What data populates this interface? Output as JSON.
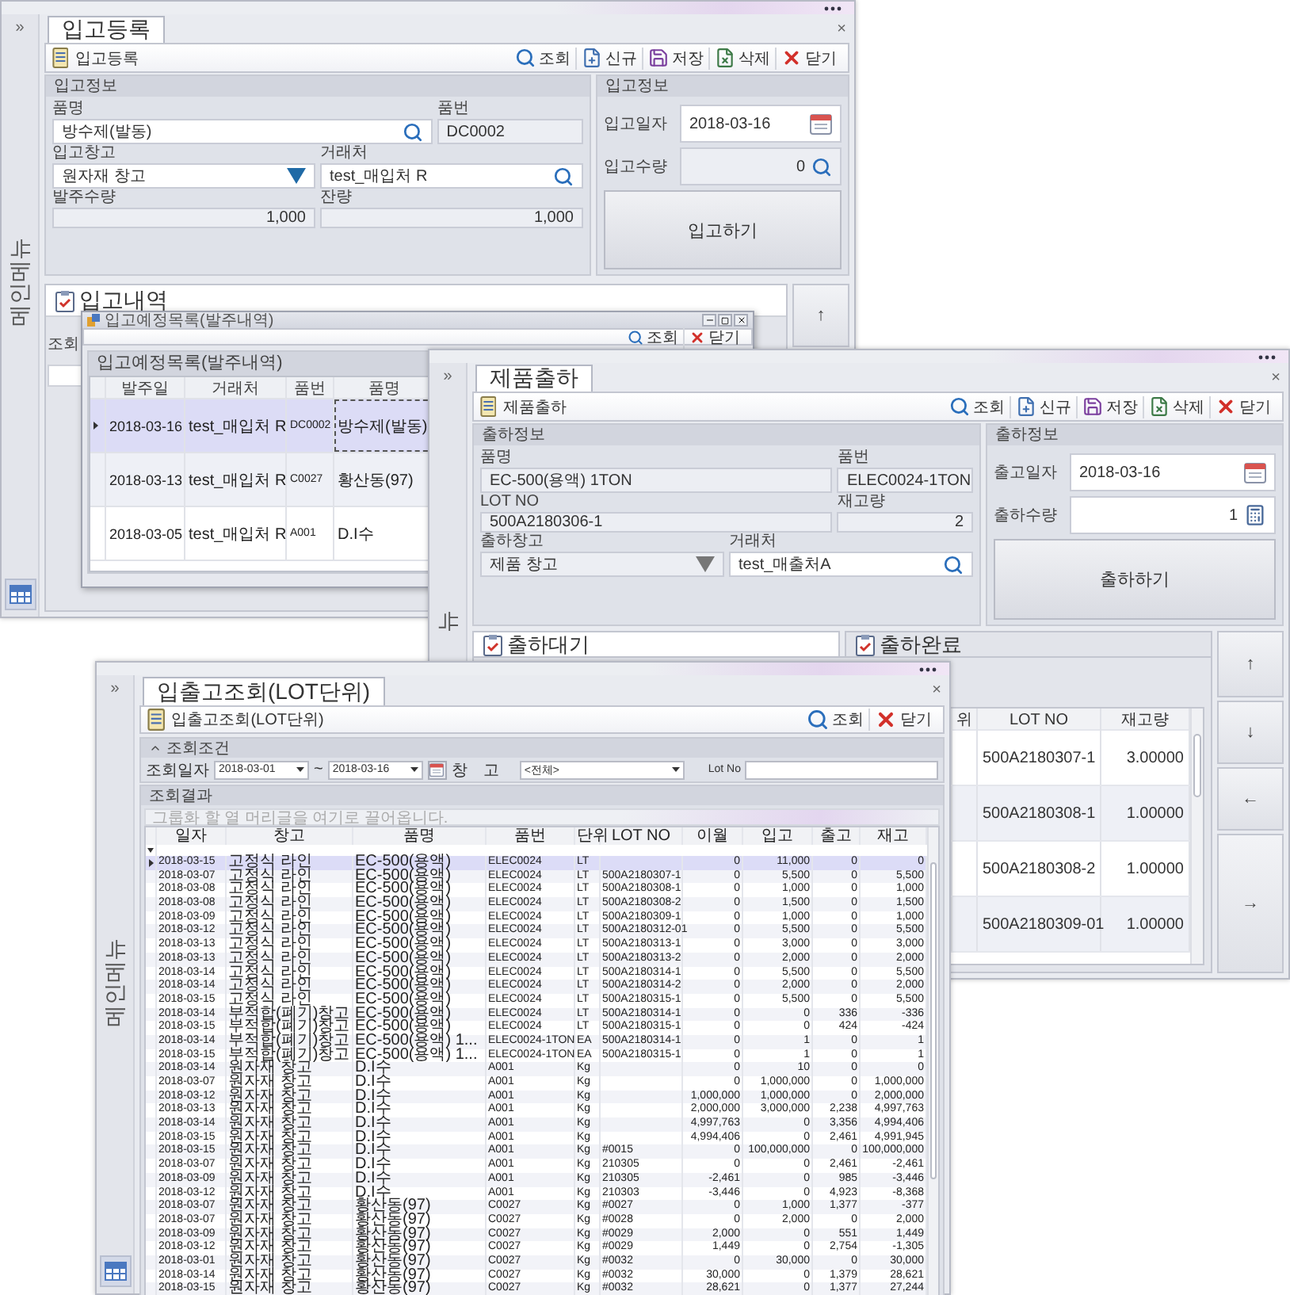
{
  "receipt_window": {
    "side_menu": {
      "expand": "»",
      "label": "메인메뉴",
      "shortcut_button": true
    },
    "tab": {
      "label": "입고등록",
      "close": "×"
    },
    "toolbar": {
      "title": "입고등록",
      "buttons": [
        {
          "kind": "search",
          "label": "조회"
        },
        {
          "kind": "new",
          "label": "신규"
        },
        {
          "kind": "save",
          "label": "저장"
        },
        {
          "kind": "delete",
          "label": "삭제"
        },
        {
          "kind": "close",
          "label": "닫기"
        }
      ]
    },
    "info": {
      "title": "입고정보",
      "rows": [
        {
          "kind": "wide-narrow",
          "fields": [
            {
              "label": "품명",
              "kind": "search",
              "value": "방수제(발동)"
            },
            {
              "label": "품번",
              "kind": "text",
              "value": "DC0002"
            }
          ]
        },
        {
          "kind": "even",
          "fields": [
            {
              "label": "입고창고",
              "kind": "dropdown",
              "disabled": false,
              "value": "원자재 창고"
            },
            {
              "label": "거래처",
              "kind": "search",
              "value": "test_매입처 R"
            }
          ]
        },
        {
          "kind": "even",
          "fields": [
            {
              "label": "발주수량",
              "kind": "amount",
              "value": "1,000"
            },
            {
              "label": "잔량",
              "kind": "amount",
              "value": "1,000"
            }
          ]
        }
      ]
    },
    "entry": {
      "title": "입고정보",
      "fields": [
        {
          "label": "입고일자",
          "kind": "date",
          "value": "2018-03-16"
        },
        {
          "label": "입고수량",
          "kind": "search-amount",
          "value": "0"
        }
      ],
      "action": "입고하기"
    },
    "history": {
      "title": "입고내역",
      "search_label": "조회",
      "side_buttons": [
        "↑"
      ]
    },
    "dialog": {
      "title": "입고예정목록(발주내역)",
      "toolbar": [
        {
          "kind": "search",
          "label": "조회"
        },
        {
          "kind": "close",
          "label": "닫기"
        }
      ],
      "group_title": "입고예정목록(발주내역)",
      "columns": [
        "발주일",
        "거래처",
        "품번",
        "품명"
      ],
      "rows": [
        {
          "selected": true,
          "cells": [
            "2018-03-16",
            "test_매입처 R",
            "DC0002",
            "방수제(발동)"
          ]
        },
        {
          "selected": false,
          "cells": [
            "2018-03-13",
            "test_매입처 R",
            "C0027",
            "황산동(97)"
          ]
        },
        {
          "selected": false,
          "cells": [
            "2018-03-05",
            "test_매입처 R",
            "A001",
            "D.I수"
          ]
        }
      ]
    }
  },
  "shipping_window": {
    "side_menu": {
      "expand": "»",
      "label": "뉴"
    },
    "tab": {
      "label": "제품출하",
      "close": "×"
    },
    "toolbar": {
      "title": "제품출하",
      "buttons": [
        {
          "kind": "search",
          "label": "조회"
        },
        {
          "kind": "new",
          "label": "신규"
        },
        {
          "kind": "save",
          "label": "저장"
        },
        {
          "kind": "delete",
          "label": "삭제"
        },
        {
          "kind": "close",
          "label": "닫기"
        }
      ]
    },
    "info": {
      "title": "출하정보",
      "rows": [
        {
          "kind": "wide-narrow",
          "fields": [
            {
              "label": "품명",
              "kind": "text",
              "value": "EC-500(용액) 1TON"
            },
            {
              "label": "품번",
              "kind": "text",
              "value": "ELEC0024-1TON"
            }
          ]
        },
        {
          "kind": "wide-narrow",
          "fields": [
            {
              "label": "LOT NO",
              "kind": "text",
              "value": "500A2180306-1"
            },
            {
              "label": "재고량",
              "kind": "amount",
              "value": "2"
            }
          ]
        },
        {
          "kind": "even",
          "fields": [
            {
              "label": "출하창고",
              "kind": "dropdown",
              "disabled": true,
              "value": "제품 창고"
            },
            {
              "label": "거래처",
              "kind": "search",
              "value": "test_매출처A"
            }
          ]
        }
      ]
    },
    "entry": {
      "title": "출하정보",
      "fields": [
        {
          "label": "출고일자",
          "kind": "date",
          "value": "2018-03-16"
        },
        {
          "label": "출하수량",
          "kind": "calc-amount",
          "value": "1"
        }
      ],
      "action": "출하하기"
    },
    "tabs": [
      {
        "label": "출하대기",
        "selected": true
      },
      {
        "label": "출하완료",
        "selected": false
      }
    ],
    "grid": {
      "columns": [
        "위",
        "LOT NO",
        "재고량"
      ],
      "rows": [
        {
          "lot_no": "500A2180307-1",
          "stock": "3.00000"
        },
        {
          "lot_no": "500A2180308-1",
          "stock": "1.00000"
        },
        {
          "lot_no": "500A2180308-2",
          "stock": "1.00000"
        },
        {
          "lot_no": "500A2180309-01",
          "stock": "1.00000"
        }
      ]
    },
    "side_buttons": [
      "↑",
      "↓",
      "←",
      "→"
    ]
  },
  "lot_window": {
    "side_menu": {
      "expand": "»",
      "label": "메인메뉴",
      "shortcut_button": true
    },
    "tab": {
      "label": "입출고조회(LOT단위)",
      "close": "×"
    },
    "toolbar": {
      "title": "입출고조회(LOT단위)",
      "buttons": [
        {
          "kind": "search",
          "label": "조회"
        },
        {
          "kind": "close",
          "label": "닫기"
        }
      ]
    },
    "filter": {
      "title": "조회조건",
      "date_label": "조회일자",
      "date_from": "2018-03-01",
      "separator": "~",
      "date_to": "2018-03-16",
      "warehouse_label": "창고",
      "warehouse": "<전체>",
      "lot_label": "Lot No"
    },
    "results": {
      "title": "조회결과",
      "group_hint": "그룹화 할 열 머리글을 여기로 끌어옵니다.",
      "columns": [
        "일자",
        "창고",
        "품명",
        "품번",
        "단위",
        "LOT NO",
        "이월",
        "입고",
        "출고",
        "재고"
      ],
      "rows": [
        {
          "selected": true,
          "date": "2018-03-15",
          "warehouse": "고정식 라인",
          "item": "EC-500(용액)",
          "code": "ELEC0024",
          "unit": "LT",
          "carried": "0",
          "in": "11,000",
          "out": "0",
          "stock": "0"
        },
        {
          "selected": false,
          "date": "2018-03-07",
          "warehouse": "고정식 라인",
          "item": "EC-500(용액)",
          "code": "ELEC0024",
          "unit": "LT",
          "lot": "500A2180307-1",
          "carried": "0",
          "in": "5,500",
          "out": "0",
          "stock": "5,500"
        },
        {
          "selected": false,
          "date": "2018-03-08",
          "warehouse": "고정식 라인",
          "item": "EC-500(용액)",
          "code": "ELEC0024",
          "unit": "LT",
          "lot": "500A2180308-1",
          "carried": "0",
          "in": "1,000",
          "out": "0",
          "stock": "1,000"
        },
        {
          "selected": false,
          "date": "2018-03-08",
          "warehouse": "고정식 라인",
          "item": "EC-500(용액)",
          "code": "ELEC0024",
          "unit": "LT",
          "lot": "500A2180308-2",
          "carried": "0",
          "in": "1,500",
          "out": "0",
          "stock": "1,500"
        },
        {
          "selected": false,
          "date": "2018-03-09",
          "warehouse": "고정식 라인",
          "item": "EC-500(용액)",
          "code": "ELEC0024",
          "unit": "LT",
          "lot": "500A2180309-1",
          "carried": "0",
          "in": "1,000",
          "out": "0",
          "stock": "1,000"
        },
        {
          "selected": false,
          "date": "2018-03-12",
          "warehouse": "고정식 라인",
          "item": "EC-500(용액)",
          "code": "ELEC0024",
          "unit": "LT",
          "lot": "500A2180312-01",
          "carried": "0",
          "in": "5,500",
          "out": "0",
          "stock": "5,500"
        },
        {
          "selected": false,
          "date": "2018-03-13",
          "warehouse": "고정식 라인",
          "item": "EC-500(용액)",
          "code": "ELEC0024",
          "unit": "LT",
          "lot": "500A2180313-1",
          "carried": "0",
          "in": "3,000",
          "out": "0",
          "stock": "3,000"
        },
        {
          "selected": false,
          "date": "2018-03-13",
          "warehouse": "고정식 라인",
          "item": "EC-500(용액)",
          "code": "ELEC0024",
          "unit": "LT",
          "lot": "500A2180313-2",
          "carried": "0",
          "in": "2,000",
          "out": "0",
          "stock": "2,000"
        },
        {
          "selected": false,
          "date": "2018-03-14",
          "warehouse": "고정식 라인",
          "item": "EC-500(용액)",
          "code": "ELEC0024",
          "unit": "LT",
          "lot": "500A2180314-1",
          "carried": "0",
          "in": "5,500",
          "out": "0",
          "stock": "5,500"
        },
        {
          "selected": false,
          "date": "2018-03-14",
          "warehouse": "고정식 라인",
          "item": "EC-500(용액)",
          "code": "ELEC0024",
          "unit": "LT",
          "lot": "500A2180314-2",
          "carried": "0",
          "in": "2,000",
          "out": "0",
          "stock": "2,000"
        },
        {
          "selected": false,
          "date": "2018-03-15",
          "warehouse": "고정식 라인",
          "item": "EC-500(용액)",
          "code": "ELEC0024",
          "unit": "LT",
          "lot": "500A2180315-1",
          "carried": "0",
          "in": "5,500",
          "out": "0",
          "stock": "5,500"
        },
        {
          "selected": false,
          "date": "2018-03-14",
          "warehouse": "부적합(폐기)창고",
          "item": "EC-500(용액)",
          "code": "ELEC0024",
          "unit": "LT",
          "lot": "500A2180314-1",
          "carried": "0",
          "in": "0",
          "out": "336",
          "stock": "-336"
        },
        {
          "selected": false,
          "date": "2018-03-15",
          "warehouse": "부적합(폐기)창고",
          "item": "EC-500(용액)",
          "code": "ELEC0024",
          "unit": "LT",
          "lot": "500A2180315-1",
          "carried": "0",
          "in": "0",
          "out": "424",
          "stock": "-424"
        },
        {
          "selected": false,
          "date": "2018-03-14",
          "warehouse": "부적합(폐기)창고",
          "item": "EC-500(용액) 1...",
          "code": "ELEC0024-1TON",
          "unit": "EA",
          "lot": "500A2180314-1",
          "carried": "0",
          "in": "1",
          "out": "0",
          "stock": "1"
        },
        {
          "selected": false,
          "date": "2018-03-15",
          "warehouse": "부적합(폐기)창고",
          "item": "EC-500(용액) 1...",
          "code": "ELEC0024-1TON",
          "unit": "EA",
          "lot": "500A2180315-1",
          "carried": "0",
          "in": "1",
          "out": "0",
          "stock": "1"
        },
        {
          "selected": false,
          "date": "2018-03-14",
          "warehouse": "원자재 창고",
          "item": "D.I수",
          "code": "A001",
          "unit": "Kg",
          "carried": "0",
          "in": "10",
          "out": "0",
          "stock": "0"
        },
        {
          "selected": false,
          "date": "2018-03-07",
          "warehouse": "원자재 창고",
          "item": "D.I수",
          "code": "A001",
          "unit": "Kg",
          "carried": "0",
          "in": "1,000,000",
          "out": "0",
          "stock": "1,000,000"
        },
        {
          "selected": false,
          "date": "2018-03-12",
          "warehouse": "원자재 창고",
          "item": "D.I수",
          "code": "A001",
          "unit": "Kg",
          "carried": "1,000,000",
          "in": "1,000,000",
          "out": "0",
          "stock": "2,000,000"
        },
        {
          "selected": false,
          "date": "2018-03-13",
          "warehouse": "원자재 창고",
          "item": "D.I수",
          "code": "A001",
          "unit": "Kg",
          "carried": "2,000,000",
          "in": "3,000,000",
          "out": "2,238",
          "stock": "4,997,763"
        },
        {
          "selected": false,
          "date": "2018-03-14",
          "warehouse": "원자재 창고",
          "item": "D.I수",
          "code": "A001",
          "unit": "Kg",
          "carried": "4,997,763",
          "in": "0",
          "out": "3,356",
          "stock": "4,994,406"
        },
        {
          "selected": false,
          "date": "2018-03-15",
          "warehouse": "원자재 창고",
          "item": "D.I수",
          "code": "A001",
          "unit": "Kg",
          "carried": "4,994,406",
          "in": "0",
          "out": "2,461",
          "stock": "4,991,945"
        },
        {
          "selected": false,
          "date": "2018-03-15",
          "warehouse": "원자재 창고",
          "item": "D.I수",
          "code": "A001",
          "unit": "Kg",
          "lot": "#0015",
          "carried": "0",
          "in": "100,000,000",
          "out": "0",
          "stock": "100,000,000"
        },
        {
          "selected": false,
          "date": "2018-03-07",
          "warehouse": "원자재 창고",
          "item": "D.I수",
          "code": "A001",
          "unit": "Kg",
          "lot": "210305",
          "carried": "0",
          "in": "0",
          "out": "2,461",
          "stock": "-2,461"
        },
        {
          "selected": false,
          "date": "2018-03-09",
          "warehouse": "원자재 창고",
          "item": "D.I수",
          "code": "A001",
          "unit": "Kg",
          "lot": "210305",
          "carried": "-2,461",
          "in": "0",
          "out": "985",
          "stock": "-3,446"
        },
        {
          "selected": false,
          "date": "2018-03-12",
          "warehouse": "원자재 창고",
          "item": "D.I수",
          "code": "A001",
          "unit": "Kg",
          "lot": "210303",
          "carried": "-3,446",
          "in": "0",
          "out": "4,923",
          "stock": "-8,368"
        },
        {
          "selected": false,
          "date": "2018-03-07",
          "warehouse": "원자재 창고",
          "item": "황산동(97)",
          "code": "C0027",
          "unit": "Kg",
          "lot": "#0027",
          "carried": "0",
          "in": "1,000",
          "out": "1,377",
          "stock": "-377"
        },
        {
          "selected": false,
          "date": "2018-03-07",
          "warehouse": "원자재 창고",
          "item": "황산동(97)",
          "code": "C0027",
          "unit": "Kg",
          "lot": "#0028",
          "carried": "0",
          "in": "2,000",
          "out": "0",
          "stock": "2,000"
        },
        {
          "selected": false,
          "date": "2018-03-09",
          "warehouse": "원자재 창고",
          "item": "황산동(97)",
          "code": "C0027",
          "unit": "Kg",
          "lot": "#0029",
          "carried": "2,000",
          "in": "0",
          "out": "551",
          "stock": "1,449"
        },
        {
          "selected": false,
          "date": "2018-03-12",
          "warehouse": "원자재 창고",
          "item": "황산동(97)",
          "code": "C0027",
          "unit": "Kg",
          "lot": "#0029",
          "carried": "1,449",
          "in": "0",
          "out": "2,754",
          "stock": "-1,305"
        },
        {
          "selected": false,
          "date": "2018-03-01",
          "warehouse": "원자재 창고",
          "item": "황산동(97)",
          "code": "C0027",
          "unit": "Kg",
          "lot": "#0032",
          "carried": "0",
          "in": "30,000",
          "out": "0",
          "stock": "30,000"
        },
        {
          "selected": false,
          "date": "2018-03-14",
          "warehouse": "원자재 창고",
          "item": "황산동(97)",
          "code": "C0027",
          "unit": "Kg",
          "lot": "#0032",
          "carried": "30,000",
          "in": "0",
          "out": "1,379",
          "stock": "28,621"
        },
        {
          "selected": false,
          "date": "2018-03-15",
          "warehouse": "원자재 창고",
          "item": "황산동(97)",
          "code": "C0027",
          "unit": "Kg",
          "lot": "#0032",
          "carried": "28,621",
          "in": "0",
          "out": "1,377",
          "stock": "27,244"
        }
      ]
    }
  }
}
